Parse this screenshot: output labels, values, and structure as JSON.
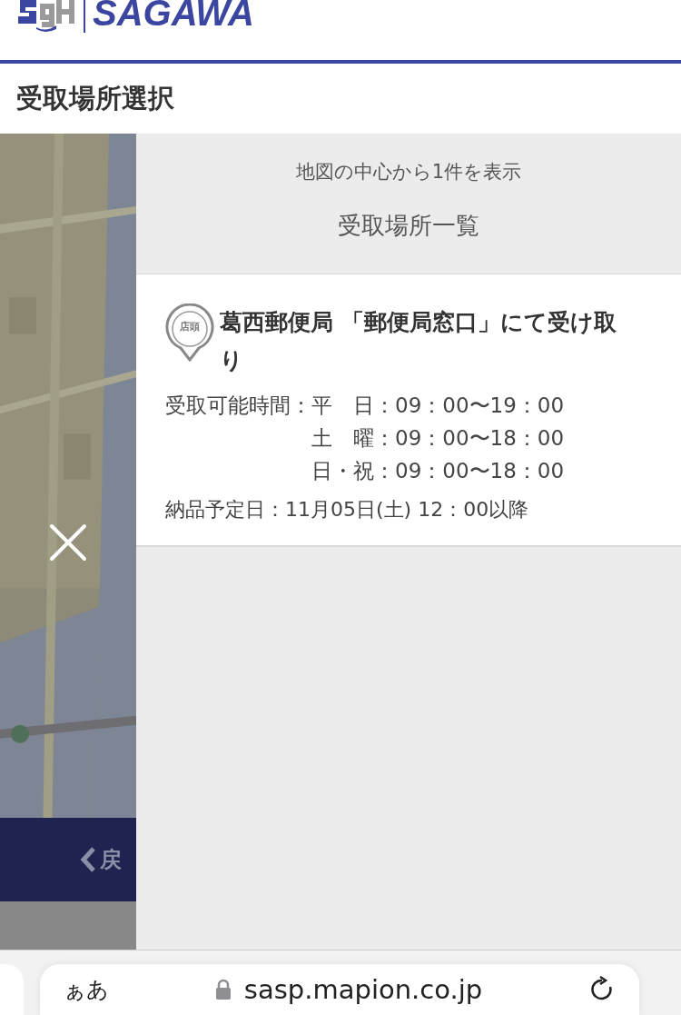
{
  "header": {
    "brand": "SAGAWA"
  },
  "page_title": "受取場所選択",
  "back_button": {
    "label": "戻"
  },
  "panel": {
    "subtitle": "地図の中心から1件を表示",
    "heading": "受取場所一覧",
    "locations": [
      {
        "badge": "店頭",
        "name": "葛西郵便局 「郵便局窓口」にて受け取り",
        "hours_label": "受取可能時間：",
        "hours": [
          {
            "days": "平　日",
            "time": "：09：00〜19：00"
          },
          {
            "days": "土　曜",
            "time": "：09：00〜18：00"
          },
          {
            "days": "日・祝",
            "time": "：09：00〜18：00"
          }
        ],
        "delivery": "納品予定日：11月05日(土) 12：00以降"
      }
    ]
  },
  "browser": {
    "text_size": "ぁあ",
    "url": "sasp.mapion.co.jp"
  }
}
